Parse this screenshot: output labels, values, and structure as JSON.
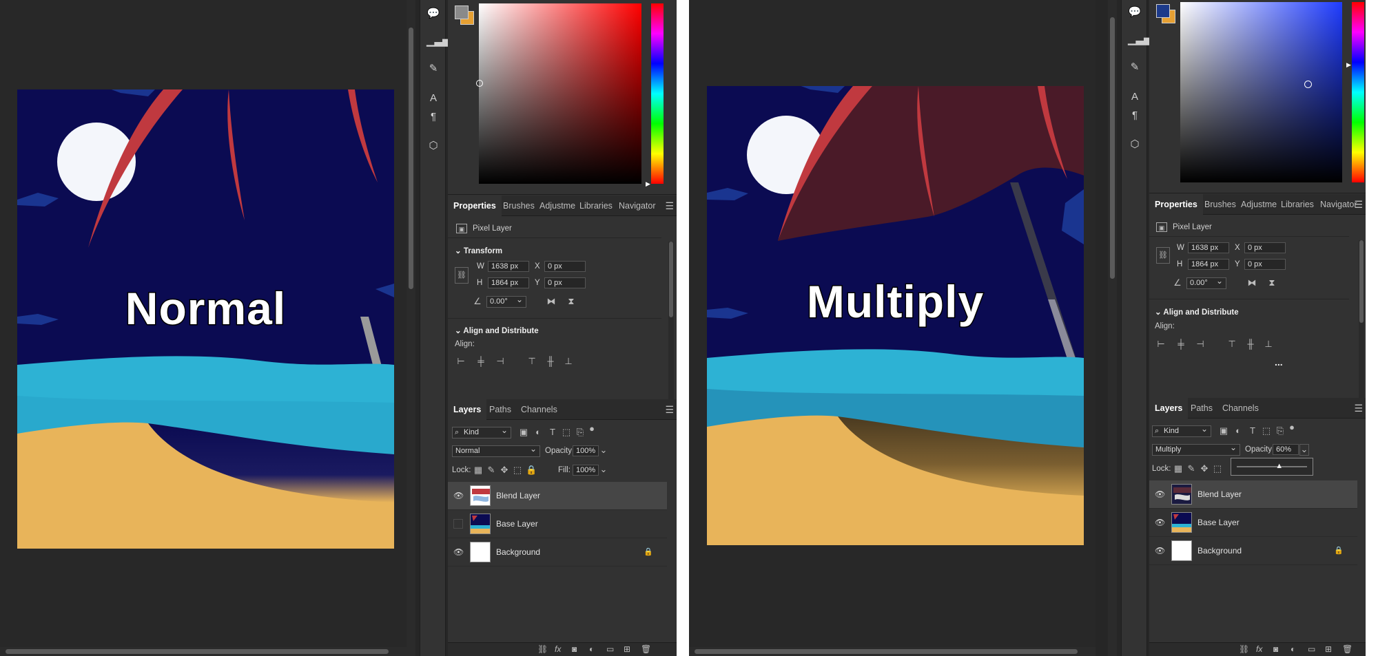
{
  "left": {
    "blend_label": "Normal",
    "color": {
      "hue_hex": "#ff0000",
      "foreground": "#8a8a8a",
      "background": "#e6a033"
    },
    "tabs": [
      "Properties",
      "Brushes",
      "Adjustme",
      "Libraries",
      "Navigator"
    ],
    "properties": {
      "layer_type": "Pixel Layer",
      "transform_title": "Transform",
      "w_label": "W",
      "w_value": "1638 px",
      "x_label": "X",
      "x_value": "0 px",
      "h_label": "H",
      "h_value": "1864 px",
      "y_label": "Y",
      "y_value": "0 px",
      "angle_value": "0.00°",
      "align_title": "Align and Distribute",
      "align_label": "Align:"
    },
    "layers_tabs": [
      "Layers",
      "Paths",
      "Channels"
    ],
    "filter_kind": "Kind",
    "blend_mode": "Normal",
    "opacity_label": "Opacity:",
    "opacity_value": "100%",
    "lock_label": "Lock:",
    "fill_label": "Fill:",
    "fill_value": "100%",
    "layers": [
      {
        "name": "Blend Layer",
        "visible": true,
        "selected": true
      },
      {
        "name": "Base Layer",
        "visible": false,
        "selected": false
      },
      {
        "name": "Background",
        "visible": true,
        "selected": false,
        "locked": true
      }
    ]
  },
  "right": {
    "blend_label": "Multiply",
    "color": {
      "hue_hex": "#1f3cff",
      "foreground": "#1c3a8a",
      "background": "#e6a033"
    },
    "tabs": [
      "Properties",
      "Brushes",
      "Adjustme",
      "Libraries",
      "Navigator"
    ],
    "properties": {
      "layer_type": "Pixel Layer",
      "w_label": "W",
      "w_value": "1638 px",
      "x_label": "X",
      "x_value": "0 px",
      "h_label": "H",
      "h_value": "1864 px",
      "y_label": "Y",
      "y_value": "0 px",
      "angle_value": "0.00°",
      "align_title": "Align and Distribute",
      "align_label": "Align:",
      "more": "..."
    },
    "layers_tabs": [
      "Layers",
      "Paths",
      "Channels"
    ],
    "filter_kind": "Kind",
    "blend_mode": "Multiply",
    "opacity_label": "Opacity:",
    "opacity_value": "60%",
    "opacity_slider_fraction": 0.6,
    "lock_label": "Lock:",
    "layers": [
      {
        "name": "Blend Layer",
        "visible": true,
        "selected": true
      },
      {
        "name": "Base Layer",
        "visible": true,
        "selected": false
      },
      {
        "name": "Background",
        "visible": true,
        "selected": false,
        "locked": true
      }
    ]
  }
}
